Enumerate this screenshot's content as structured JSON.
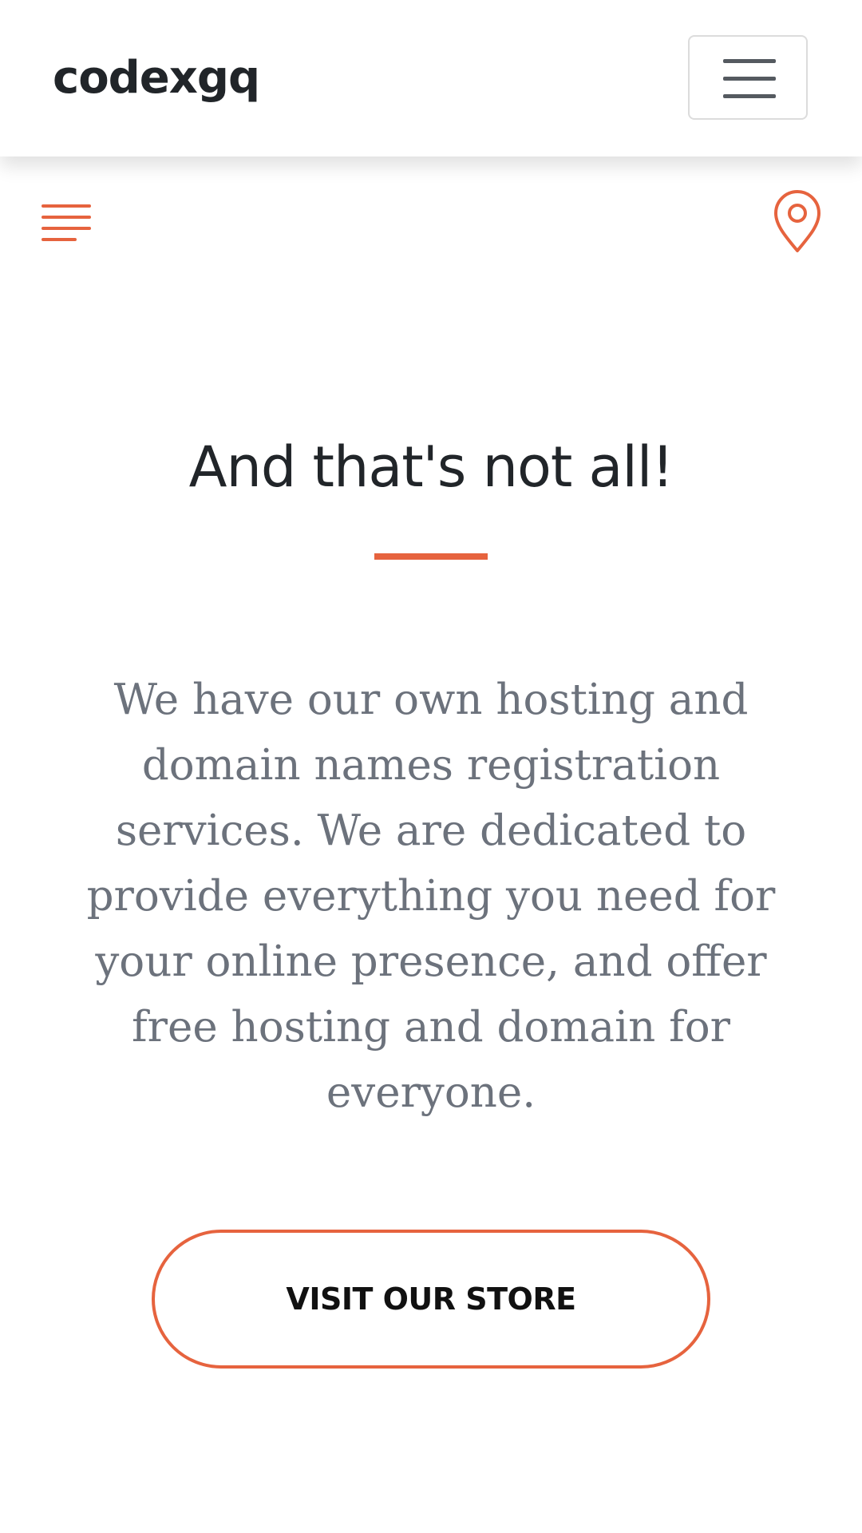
{
  "navbar": {
    "brand": "codexgq",
    "toggler_icon": "hamburger-icon"
  },
  "subbar": {
    "left_icon": "align-lines-icon",
    "right_icon": "map-pin-icon",
    "accent_color": "#e6633e"
  },
  "section": {
    "heading": "And that's not all!",
    "description": "We have our own hosting and domain names registration services. We are dedicated to provide everything you need for your online presence, and offer free hosting and domain for everyone.",
    "button_label": "VISIT OUR STORE"
  },
  "colors": {
    "accent": "#e6633e",
    "heading": "#212529",
    "body_text": "#6c727c"
  }
}
